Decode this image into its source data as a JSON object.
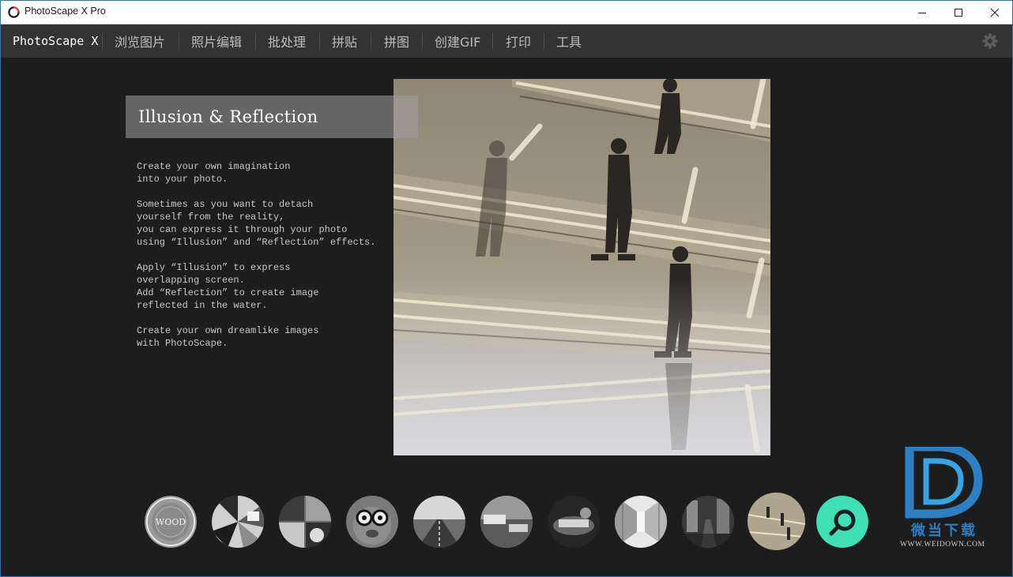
{
  "window": {
    "title": "PhotoScape X Pro",
    "controls": [
      "minimize-icon",
      "maximize-icon",
      "close-icon"
    ]
  },
  "menu": {
    "brand": "PhotoScape X",
    "items": [
      "浏览图片",
      "照片编辑",
      "批处理",
      "拼贴",
      "拼图",
      "创建GIF",
      "打印",
      "工具"
    ],
    "settings_icon": "gear-icon"
  },
  "feature": {
    "title": "Illusion & Reflection",
    "paragraphs": [
      "Create your own imagination\ninto your photo.",
      "Sometimes as you want to detach\nyourself from the reality,\nyou can express it through your photo\nusing “Illusion” and “Reflection” effects.",
      "Apply “Illusion” to express\noverlapping screen.\nAdd “Reflection” to create image\nreflected in the water.",
      "Create your own dreamlike images\nwith PhotoScape."
    ]
  },
  "thumbnails": {
    "count": 11,
    "active_index": 10,
    "first_label": "WOOD",
    "last_icon": "magnifier-icon",
    "accent": "#3ee0b4"
  },
  "watermark": {
    "name": "微当下载",
    "url": "WWW.WEIDOWN.COM",
    "color": "#2b7fc2"
  }
}
